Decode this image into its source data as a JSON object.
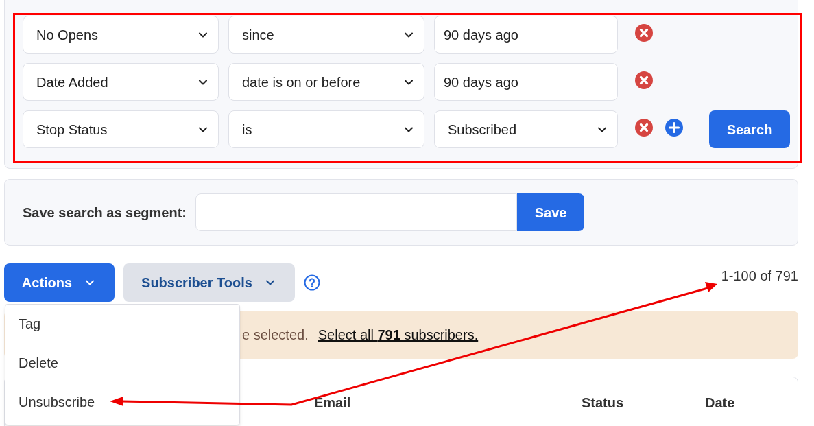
{
  "filters": [
    {
      "field": "No Opens",
      "operator": "since",
      "value": {
        "kind": "text",
        "text": "90 days ago"
      }
    },
    {
      "field": "Date Added",
      "operator": "date is on or before",
      "value": {
        "kind": "text",
        "text": "90 days ago"
      }
    },
    {
      "field": "Stop Status",
      "operator": "is",
      "value": {
        "kind": "select",
        "text": "Subscribed"
      }
    }
  ],
  "search_button": "Search",
  "segment": {
    "label": "Save search as segment:",
    "button": "Save"
  },
  "toolbar": {
    "actions": "Actions",
    "tools": "Subscriber Tools",
    "pagination": "1-100 of 791"
  },
  "actions_menu": {
    "expanded": true,
    "items": [
      "Tag",
      "Delete",
      "Unsubscribe"
    ]
  },
  "banner": {
    "text": "e selected.",
    "link": "Select all **791** subscribers."
  },
  "table": {
    "columns": [
      "Email",
      "Status",
      "Date"
    ]
  }
}
